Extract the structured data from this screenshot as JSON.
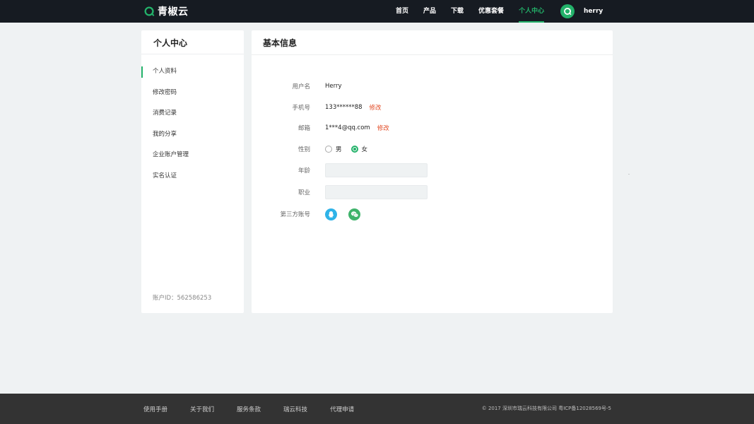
{
  "header": {
    "brand": "青椒云",
    "nav": [
      {
        "label": "首页",
        "active": false
      },
      {
        "label": "产品",
        "active": false
      },
      {
        "label": "下载",
        "active": false
      },
      {
        "label": "优惠套餐",
        "active": false
      },
      {
        "label": "个人中心",
        "active": true
      }
    ],
    "username": "herry",
    "colors": {
      "bg": "#161b22",
      "accent": "#23b26a"
    }
  },
  "sidebar": {
    "title": "个人中心",
    "items": [
      {
        "label": "个人资料",
        "active": true
      },
      {
        "label": "修改密码",
        "active": false
      },
      {
        "label": "消费记录",
        "active": false
      },
      {
        "label": "我的分享",
        "active": false
      },
      {
        "label": "企业账户管理",
        "active": false
      },
      {
        "label": "实名认证",
        "active": false
      }
    ],
    "account_id": "账户ID：562586253"
  },
  "main": {
    "title": "基本信息",
    "username": {
      "label": "用户名",
      "value": "Herry"
    },
    "phone": {
      "label": "手机号",
      "value": "133******88",
      "action": "修改"
    },
    "email": {
      "label": "邮箱",
      "value": "1***4@qq.com",
      "action": "修改"
    },
    "gender": {
      "label": "性别",
      "options": [
        "男",
        "女"
      ],
      "selected": "女"
    },
    "age": {
      "label": "年龄",
      "value": ""
    },
    "job": {
      "label": "职业",
      "value": ""
    },
    "third_party": {
      "label": "第三方账号",
      "icons": [
        "qq-icon",
        "wechat-icon"
      ]
    }
  },
  "footer": {
    "links": [
      "使用手册",
      "关于我们",
      "服务条款",
      "瑞云科技",
      "代理申请"
    ],
    "copyright": "© 2017 深圳市瑞云科技有限公司 粤ICP备12028569号-5"
  }
}
